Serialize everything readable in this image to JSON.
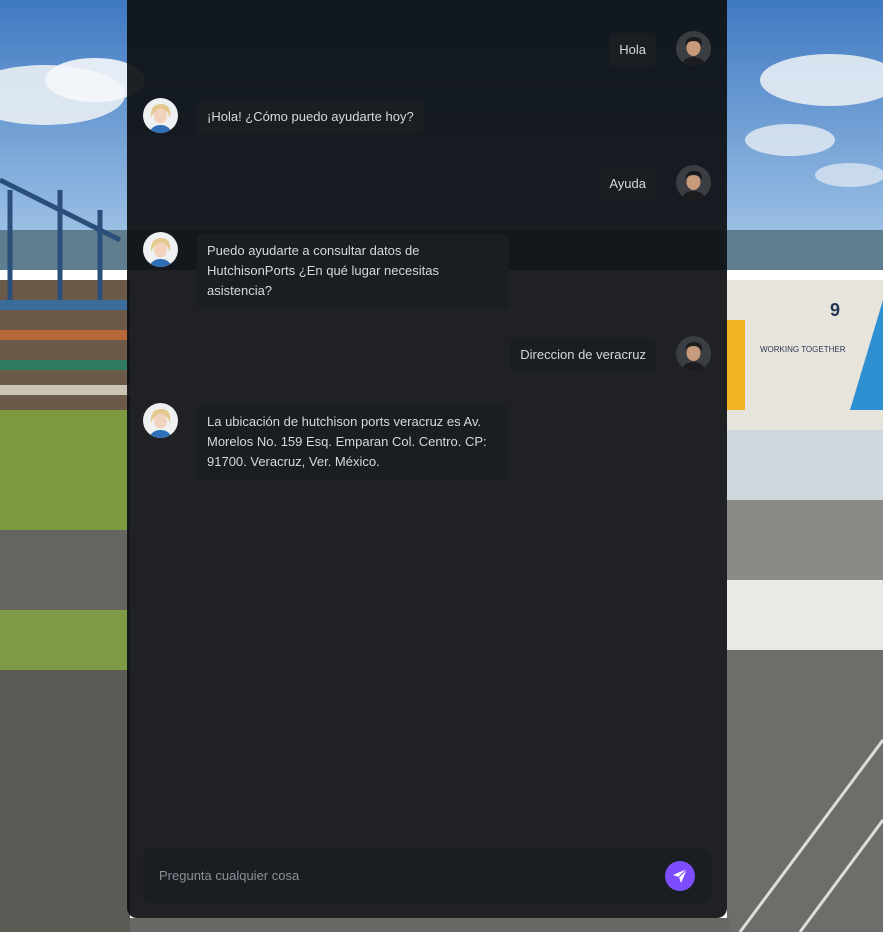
{
  "chat": {
    "messages": [
      {
        "role": "user",
        "text": "Hola"
      },
      {
        "role": "bot",
        "text": "¡Hola! ¿Cómo puedo ayudarte hoy?"
      },
      {
        "role": "user",
        "text": "Ayuda"
      },
      {
        "role": "bot",
        "text": "Puedo ayudarte a consultar datos de HutchisonPorts ¿En qué lugar necesitas asistencia?"
      },
      {
        "role": "user",
        "text": "Direccion de veracruz"
      },
      {
        "role": "bot",
        "text": "La ubicación de hutchison ports veracruz es Av. Morelos No. 159 Esq. Emparan Col. Centro. CP: 91700. Veracruz, Ver. México."
      }
    ]
  },
  "input": {
    "placeholder": "Pregunta cualquier cosa",
    "value": ""
  },
  "background": {
    "building_sign": "WORKING TOGETHER",
    "building_number": "9"
  },
  "colors": {
    "panel": "#0e1013",
    "bubble": "#1a1d22",
    "text": "#d6d8dc",
    "accent": "#7c4dff"
  },
  "icons": {
    "send": "send-icon",
    "user_avatar": "user-avatar-man",
    "bot_avatar": "assistant-avatar-woman"
  }
}
